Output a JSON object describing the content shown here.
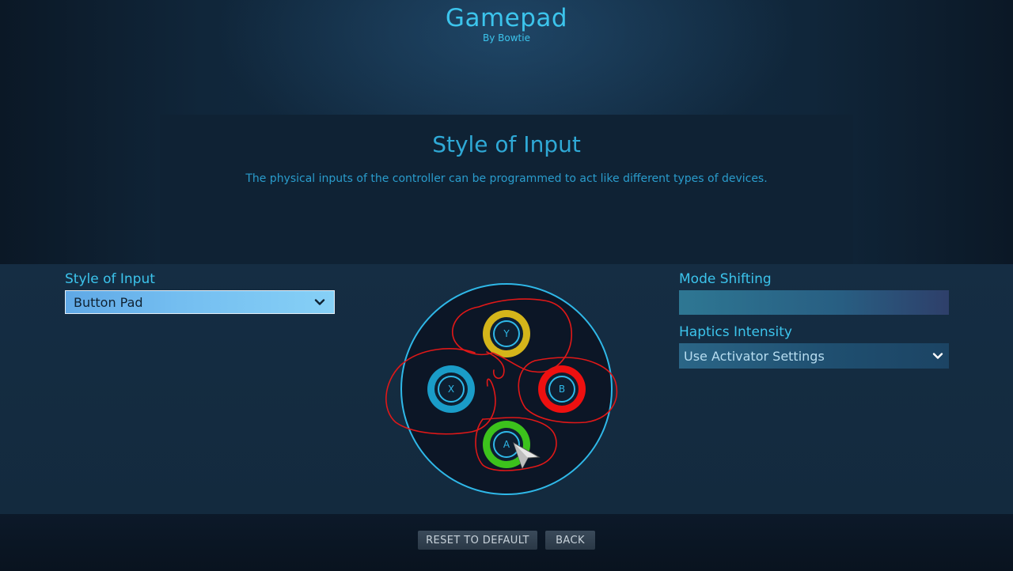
{
  "header": {
    "title": "Gamepad",
    "subtitle": "By Bowtie"
  },
  "info": {
    "title": "Style of Input",
    "description": "The physical inputs of the controller can be programmed to act like different types of devices."
  },
  "left": {
    "style_label": "Style of Input",
    "style_value": "Button Pad"
  },
  "right": {
    "mode_shifting_label": "Mode Shifting",
    "haptics_label": "Haptics Intensity",
    "haptics_value": "Use Activator Settings"
  },
  "pad": {
    "buttons": [
      {
        "label": "Y",
        "color": "#d4b51a"
      },
      {
        "label": "X",
        "color": "#1a9cc8"
      },
      {
        "label": "B",
        "color": "#ee1010"
      },
      {
        "label": "A",
        "color": "#3cc21c"
      }
    ],
    "ring_color": "#2fb8e8"
  },
  "footer": {
    "reset_label": "RESET TO DEFAULT",
    "back_label": "BACK"
  },
  "colors": {
    "accent": "#3cc4ec",
    "annotation": "#e01818"
  },
  "icons": [
    "chevron-down-icon",
    "mouse-cursor-icon"
  ]
}
